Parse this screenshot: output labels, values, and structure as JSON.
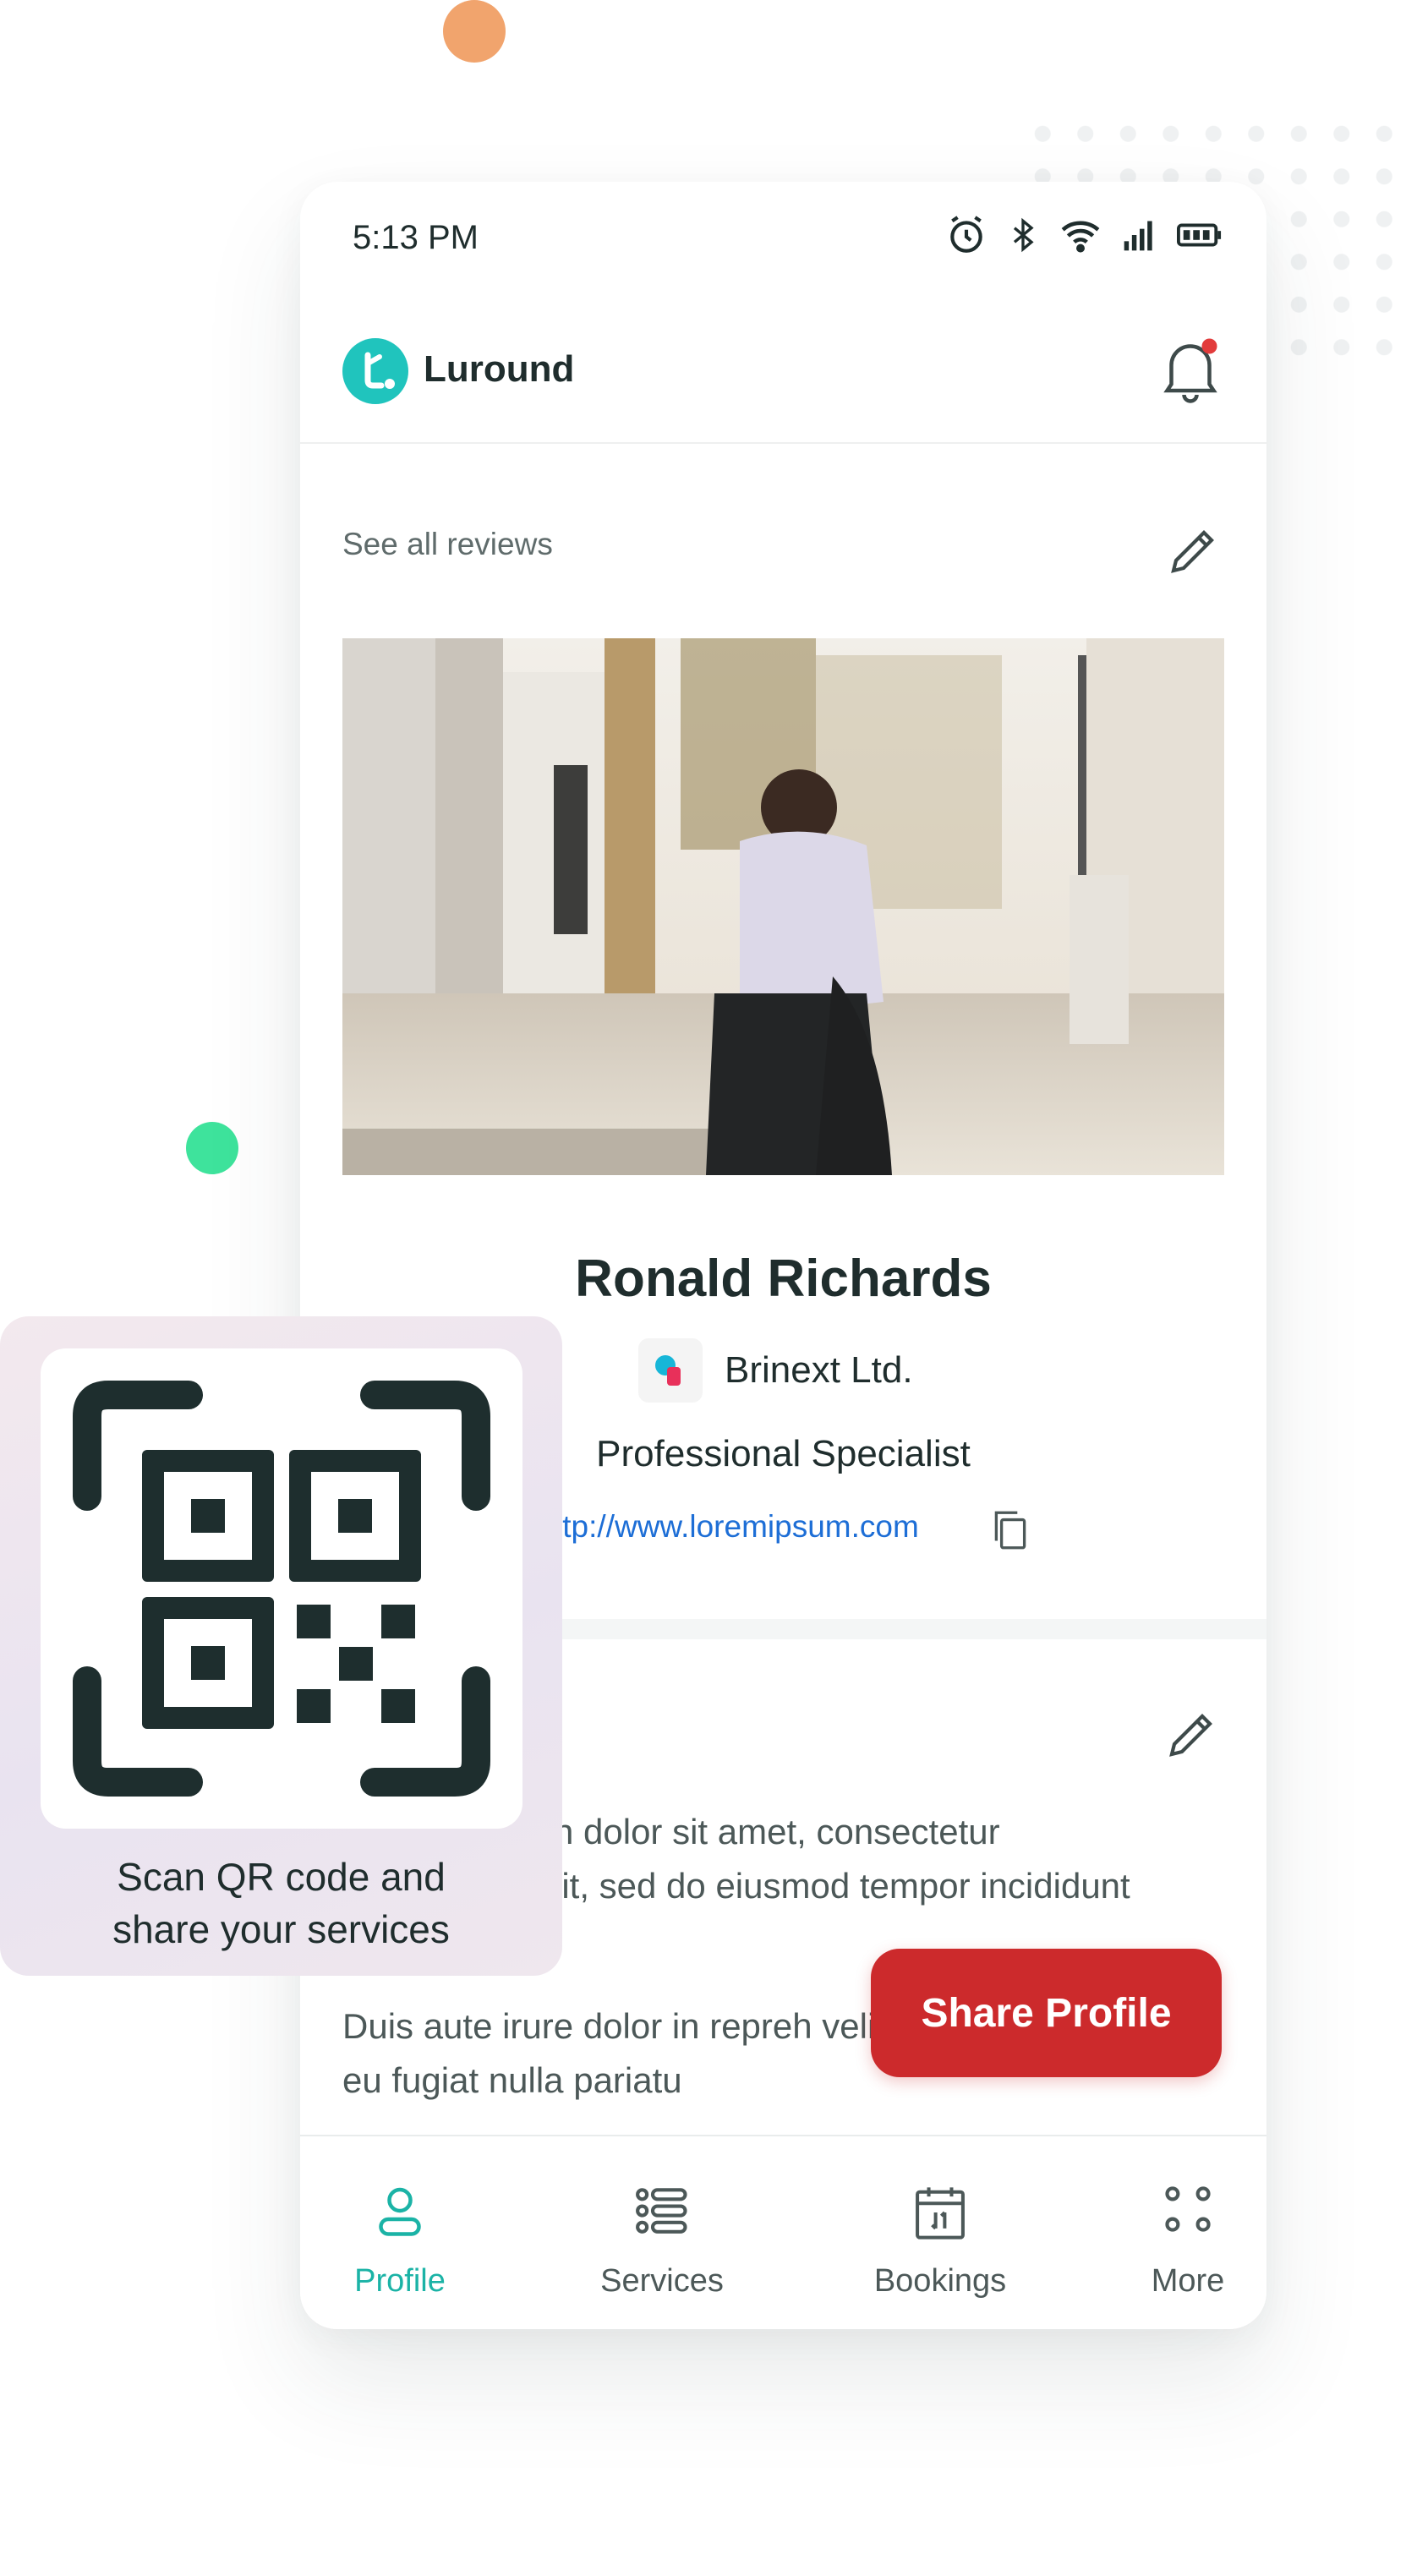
{
  "status_bar": {
    "time": "5:13 PM"
  },
  "app": {
    "brand": "Luround"
  },
  "profile": {
    "reviews_link": "See all reviews",
    "name": "Ronald Richards",
    "company": "Brinext Ltd.",
    "role": "Professional Specialist",
    "website": "ttp://www.loremipsum.com"
  },
  "bio": {
    "line1": "n dolor sit amet, consectetur",
    "line2": "lit, sed do eiusmod tempor incididunt",
    "para2": "Duis aute irure dolor in repreh velit esse cillum dolore eu fugiat nulla pariatu"
  },
  "share_button": {
    "label": "Share Profile"
  },
  "qr_card": {
    "caption_line1": "Scan QR code and",
    "caption_line2": "share your services"
  },
  "bottom_nav": {
    "items": [
      {
        "label": "Profile",
        "icon": "person-icon",
        "active": true
      },
      {
        "label": "Services",
        "icon": "list-icon",
        "active": false
      },
      {
        "label": "Bookings",
        "icon": "calendar-icon",
        "active": false
      },
      {
        "label": "More",
        "icon": "more-icon",
        "active": false
      }
    ]
  },
  "colors": {
    "accent": "#1bb3a6",
    "primary_button": "#cc2a2c",
    "link": "#1d6ed6",
    "notification_dot": "#e23b3b"
  }
}
